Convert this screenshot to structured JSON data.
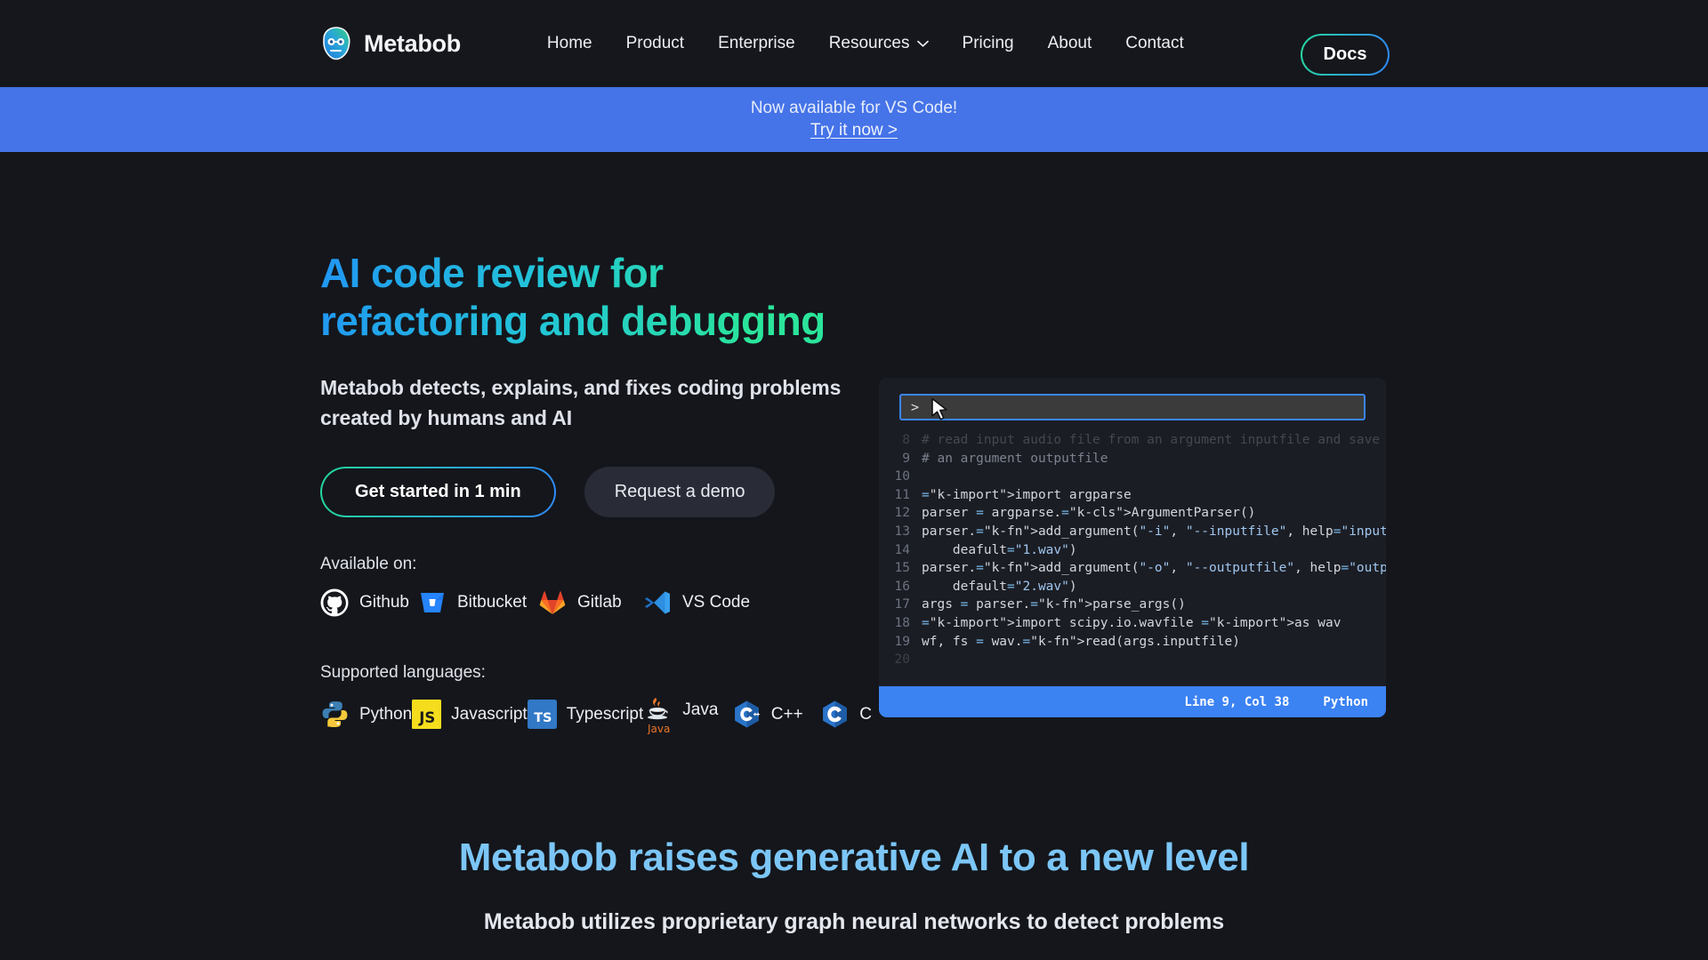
{
  "brand": {
    "name": "Metabob",
    "logo_icon": "metabob-face-logo"
  },
  "nav": {
    "items": [
      {
        "label": "Home"
      },
      {
        "label": "Product"
      },
      {
        "label": "Enterprise"
      },
      {
        "label": "Resources",
        "icon": "chevron-down-icon"
      },
      {
        "label": "Pricing"
      },
      {
        "label": "About"
      },
      {
        "label": "Contact"
      }
    ],
    "docs_label": "Docs"
  },
  "banner": {
    "title": "Now available for VS Code!",
    "link": "Try it now >",
    "background": "#4573e8"
  },
  "hero": {
    "headline": "AI code review for refactoring and debugging",
    "subheading": "Metabob detects, explains, and fixes coding problems created by humans and AI",
    "primary_cta": "Get started in 1 min",
    "secondary_cta": "Request a demo",
    "gradient_start": "#2196f3",
    "gradient_end": "#2ae59b",
    "available_label": "Available on:",
    "platforms": [
      {
        "label": "Github",
        "icon": "github-icon"
      },
      {
        "label": "Bitbucket",
        "icon": "bitbucket-icon"
      },
      {
        "label": "Gitlab",
        "icon": "gitlab-icon"
      },
      {
        "label": "VS Code",
        "icon": "vscode-icon"
      }
    ],
    "languages_label": "Supported languages:",
    "languages": [
      {
        "label": "Python",
        "icon": "python-icon"
      },
      {
        "label": "Javascript",
        "icon": "javascript-icon"
      },
      {
        "label": "Typescript",
        "icon": "typescript-icon"
      },
      {
        "label": "Java",
        "icon": "java-icon"
      },
      {
        "label": "C++",
        "icon": "cpp-icon"
      },
      {
        "label": "C",
        "icon": "c-icon"
      }
    ]
  },
  "editor": {
    "command_prompt": ">",
    "command_value": "",
    "cursor_icon": "mouse-pointer-icon",
    "status_position": "Line 9, Col 38",
    "status_language": "Python",
    "lines": [
      {
        "n": "8",
        "faded": true,
        "text": "# read input audio file from an argument inputfile and save to"
      },
      {
        "n": "9",
        "faded": false,
        "text": "# an argument outputfile"
      },
      {
        "n": "10",
        "faded": false,
        "text": ""
      },
      {
        "n": "11",
        "faded": false,
        "text": "import argparse"
      },
      {
        "n": "12",
        "faded": false,
        "text": "parser = argparse.ArgumentParser()"
      },
      {
        "n": "13",
        "faded": false,
        "text": "parser.add_argument(\"-i\", \"--inputfile\", help=\"input file\","
      },
      {
        "n": "14",
        "faded": false,
        "text": "    deafult=\"1.wav\")"
      },
      {
        "n": "15",
        "faded": false,
        "text": "parser.add_argument(\"-o\", \"--outputfile\", help=\"output file\","
      },
      {
        "n": "16",
        "faded": false,
        "text": "    default=\"2.wav\")"
      },
      {
        "n": "17",
        "faded": false,
        "text": "args = parser.parse_args()"
      },
      {
        "n": "18",
        "faded": false,
        "text": "import scipy.io.wavfile as wav"
      },
      {
        "n": "19",
        "faded": false,
        "text": "wf, fs = wav.read(args.inputfile)"
      },
      {
        "n": "20",
        "faded": true,
        "text": ""
      }
    ]
  },
  "section2": {
    "title": "Metabob raises generative AI to a new level",
    "subtitle": "Metabob utilizes proprietary graph neural networks to detect problems"
  }
}
